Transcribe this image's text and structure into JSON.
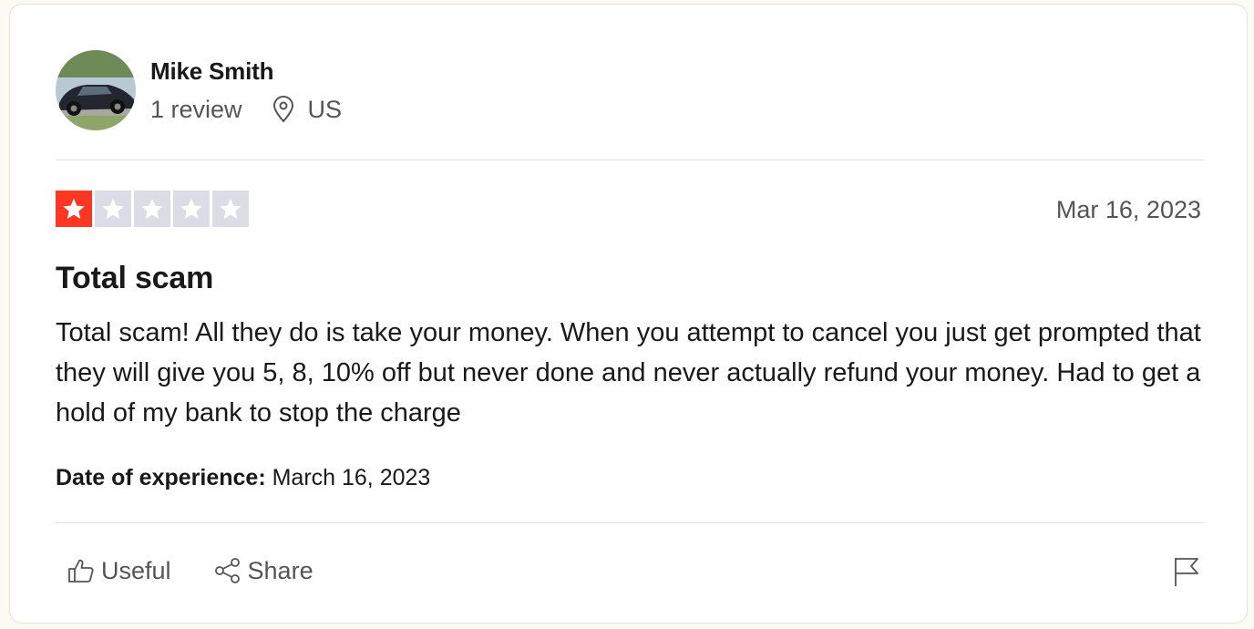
{
  "reviewer": {
    "name": "Mike Smith",
    "review_count": "1 review",
    "country": "US"
  },
  "review": {
    "rating": 1,
    "max_rating": 5,
    "date": "Mar 16, 2023",
    "title": "Total scam",
    "body": "Total scam! All they do is take your money. When you attempt to cancel you just get prompted that they will give you 5, 8, 10% off but never done and never actually refund your money. Had to get a hold of my bank to stop the charge",
    "experience_label": "Date of experience:",
    "experience_date": "March 16, 2023"
  },
  "actions": {
    "useful_label": "Useful",
    "share_label": "Share"
  },
  "icons": {
    "location": "location-pin-icon",
    "useful": "thumbs-up-icon",
    "share": "share-icon",
    "report": "flag-icon"
  },
  "colors": {
    "star_filled": "#ff3722",
    "star_empty": "#dcdce6",
    "text": "#191919",
    "muted": "#555555"
  }
}
